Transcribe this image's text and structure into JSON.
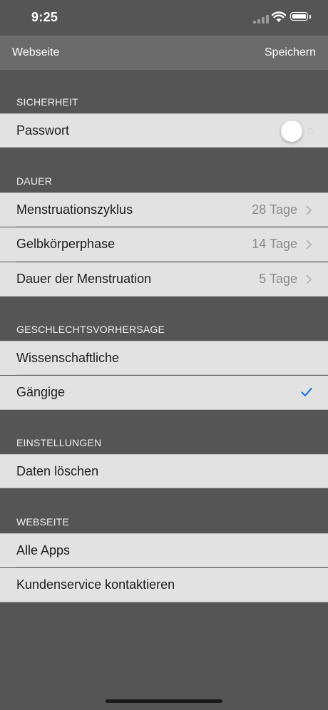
{
  "status_bar": {
    "time": "9:25"
  },
  "nav": {
    "left_label": "Webseite",
    "right_label": "Speichern"
  },
  "sections": {
    "security": {
      "header": "SICHERHEIT",
      "password": {
        "label": "Passwort",
        "toggle_on": false
      }
    },
    "duration": {
      "header": "DAUER",
      "rows": [
        {
          "label": "Menstruationszyklus",
          "value": "28 Tage"
        },
        {
          "label": "Gelbkörperphase",
          "value": "14 Tage"
        },
        {
          "label": "Dauer der Menstruation",
          "value": "5 Tage"
        }
      ]
    },
    "gender_prediction": {
      "header": "GESCHLECHTSVORHERSAGE",
      "rows": [
        {
          "label": "Wissenschaftliche",
          "selected": false
        },
        {
          "label": "Gängige",
          "selected": true
        }
      ]
    },
    "settings": {
      "header": "EINSTELLUNGEN",
      "rows": [
        {
          "label": "Daten löschen"
        }
      ]
    },
    "website": {
      "header": "WEBSEITE",
      "rows": [
        {
          "label": "Alle Apps"
        },
        {
          "label": "Kundenservice kontaktieren"
        }
      ]
    }
  },
  "colors": {
    "background": "#555555",
    "nav_bar": "#6b6b6b",
    "row_background": "#e2e2e2",
    "accent_check": "#1e7be0",
    "value_text": "#8b8b8b"
  },
  "icons": {
    "signal": "cellular-signal-icon",
    "wifi": "wifi-icon",
    "battery": "battery-icon",
    "chevron": "chevron-right-icon",
    "check": "checkmark-icon"
  }
}
